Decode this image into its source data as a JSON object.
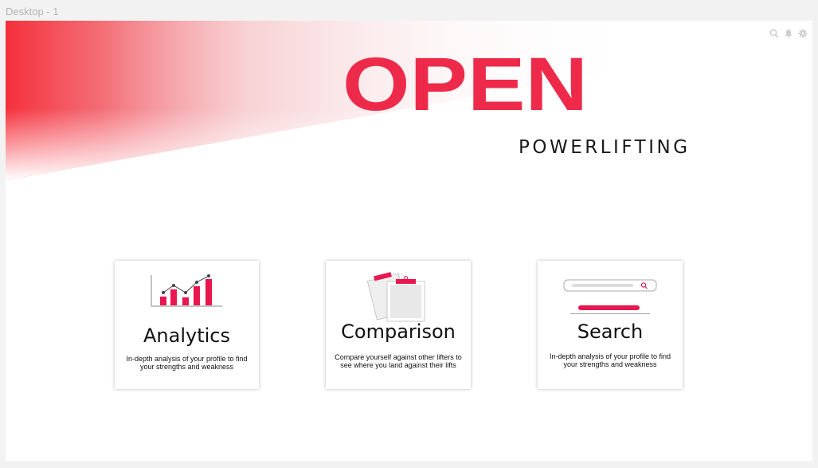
{
  "frame": {
    "label": "Desktop - 1"
  },
  "colors": {
    "brand": "#ee2a4a",
    "accent": "#e8174f"
  },
  "top_icons": [
    "search-icon",
    "bell-icon",
    "gear-icon"
  ],
  "logo": {
    "main": "OPEN",
    "sub": "POWERLIFTING"
  },
  "cards": [
    {
      "title": "Analytics",
      "description": "In-depth analysis of your profile to find your strengths and weakness",
      "icon": "bar-chart-illustration"
    },
    {
      "title": "Comparison",
      "description": "Compare yourself against other lifters to see where you land against their lifts",
      "icon": "clipboards-illustration"
    },
    {
      "title": "Search",
      "description": "In-depth analysis of your profile to find your strengths and weakness",
      "icon": "search-bar-illustration"
    }
  ]
}
